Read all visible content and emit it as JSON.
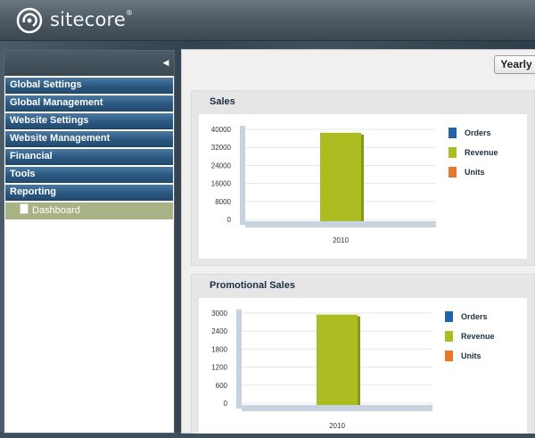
{
  "header": {
    "brand": "sitecore",
    "logo_icon": "sitecore-logo-icon"
  },
  "sidebar": {
    "collapse_icon": "collapse-arrow-icon",
    "items": [
      {
        "label": "Global Settings"
      },
      {
        "label": "Global Management"
      },
      {
        "label": "Website Settings"
      },
      {
        "label": "Website Management"
      },
      {
        "label": "Financial"
      },
      {
        "label": "Tools"
      },
      {
        "label": "Reporting"
      }
    ],
    "sub_items": [
      {
        "label": "Dashboard",
        "icon": "document-icon",
        "selected": true
      }
    ]
  },
  "toolbar": {
    "yearly_label": "Yearly"
  },
  "colors": {
    "orders": "#1f63a8",
    "revenue": "#acbd22",
    "units": "#e8772b"
  },
  "charts": [
    {
      "title": "Sales"
    },
    {
      "title": "Promotional Sales"
    }
  ],
  "chart_data": [
    {
      "type": "bar",
      "title": "Sales",
      "categories": [
        "2010"
      ],
      "yticks": [
        "40000",
        "32000",
        "24000",
        "16000",
        "8000",
        "0"
      ],
      "ylim": [
        0,
        40000
      ],
      "legend": [
        "Orders",
        "Revenue",
        "Units"
      ],
      "legend_position": "right",
      "series": [
        {
          "name": "Orders",
          "values": [
            0
          ]
        },
        {
          "name": "Revenue",
          "values": [
            38500
          ]
        },
        {
          "name": "Units",
          "values": [
            0
          ]
        }
      ]
    },
    {
      "type": "bar",
      "title": "Promotional Sales",
      "categories": [
        "2010"
      ],
      "yticks": [
        "3000",
        "2400",
        "1800",
        "1200",
        "600",
        "0"
      ],
      "ylim": [
        0,
        3000
      ],
      "legend": [
        "Orders",
        "Revenue",
        "Units"
      ],
      "legend_position": "right",
      "series": [
        {
          "name": "Orders",
          "values": [
            0
          ]
        },
        {
          "name": "Revenue",
          "values": [
            2950
          ]
        },
        {
          "name": "Units",
          "values": [
            0
          ]
        }
      ]
    }
  ]
}
